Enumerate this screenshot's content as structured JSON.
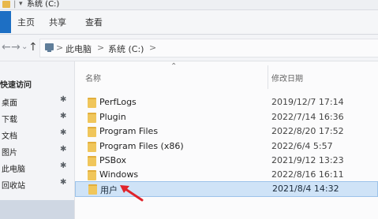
{
  "window": {
    "title": "系统 (C:)"
  },
  "ribbon": {
    "tabs": [
      "主页",
      "共享",
      "查看"
    ]
  },
  "address": {
    "back": "←",
    "forward": "→",
    "recent": "⌄",
    "up": "↑",
    "crumbs": [
      "此电脑",
      "系统 (C:)"
    ],
    "sep": ">"
  },
  "sidebar": {
    "quick_access": "快速访问",
    "items": [
      {
        "label": "桌面",
        "pinned": true
      },
      {
        "label": "下载",
        "pinned": true
      },
      {
        "label": "文档",
        "pinned": true
      },
      {
        "label": "图片",
        "pinned": true
      },
      {
        "label": "此电脑",
        "pinned": true
      },
      {
        "label": "回收站",
        "pinned": true
      }
    ],
    "pin_glyph": "✱"
  },
  "columns": {
    "name": "名称",
    "modified": "修改日期"
  },
  "files": [
    {
      "name": "PerfLogs",
      "modified": "2019/12/7 17:14"
    },
    {
      "name": "Plugin",
      "modified": "2022/7/14 16:36"
    },
    {
      "name": "Program Files",
      "modified": "2022/8/20 17:52"
    },
    {
      "name": "Program Files (x86)",
      "modified": "2022/6/4 5:57"
    },
    {
      "name": "PSBox",
      "modified": "2021/9/12 13:23"
    },
    {
      "name": "Windows",
      "modified": "2022/8/16 16:11"
    },
    {
      "name": "用户",
      "modified": "2021/8/4 14:32",
      "selected": true
    }
  ],
  "colors": {
    "accent": "#1d6fc4",
    "folder": "#f0c65b",
    "selection": "#cfe3f7",
    "arrow": "#e0242b"
  }
}
